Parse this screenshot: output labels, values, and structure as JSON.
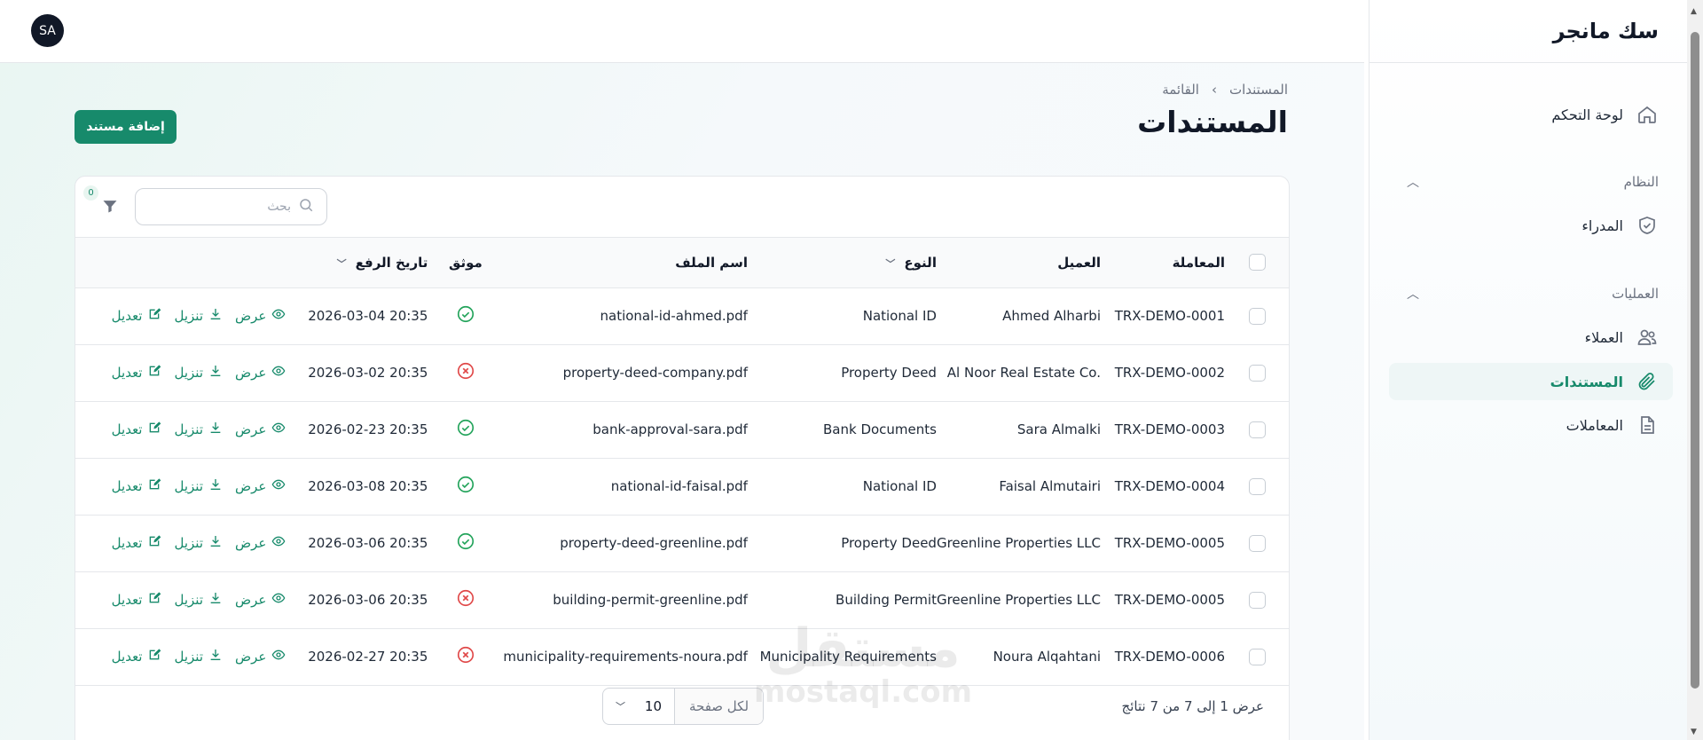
{
  "app": {
    "brand": "سك مانجر",
    "avatar_initials": "SA"
  },
  "sidebar": {
    "dashboard": "لوحة التحكم",
    "system_group": "النظام",
    "admins": "المدراء",
    "operations_group": "العمليات",
    "clients": "العملاء",
    "documents": "المستندات",
    "transactions": "المعاملات"
  },
  "header": {
    "breadcrumb_root": "المستندات",
    "breadcrumb_sep": "›",
    "breadcrumb_current": "القائمة",
    "title": "المستندات",
    "add_button": "إضافة مستند"
  },
  "toolbar": {
    "search_placeholder": "بحث",
    "filter_count": "0"
  },
  "table": {
    "columns": {
      "transaction": "المعاملة",
      "client": "العميل",
      "type": "النوع",
      "filename": "اسم الملف",
      "verified": "موثق",
      "upload_date": "تاريخ الرفع"
    },
    "actions": {
      "view": "عرض",
      "download": "تنزيل",
      "edit": "تعديل"
    },
    "rows": [
      {
        "transaction": "TRX-DEMO-0001",
        "client": "Ahmed Alharbi",
        "type": "National ID",
        "filename": "national-id-ahmed.pdf",
        "verified": true,
        "date": "2026-03-04 20:35"
      },
      {
        "transaction": "TRX-DEMO-0002",
        "client": "Al Noor Real Estate Co.",
        "type": "Property Deed",
        "filename": "property-deed-company.pdf",
        "verified": false,
        "date": "2026-03-02 20:35"
      },
      {
        "transaction": "TRX-DEMO-0003",
        "client": "Sara Almalki",
        "type": "Bank Documents",
        "filename": "bank-approval-sara.pdf",
        "verified": true,
        "date": "2026-02-23 20:35"
      },
      {
        "transaction": "TRX-DEMO-0004",
        "client": "Faisal Almutairi",
        "type": "National ID",
        "filename": "national-id-faisal.pdf",
        "verified": true,
        "date": "2026-03-08 20:35"
      },
      {
        "transaction": "TRX-DEMO-0005",
        "client": "Greenline Properties LLC",
        "type": "Property Deed",
        "filename": "property-deed-greenline.pdf",
        "verified": true,
        "date": "2026-03-06 20:35"
      },
      {
        "transaction": "TRX-DEMO-0005",
        "client": "Greenline Properties LLC",
        "type": "Building Permit",
        "filename": "building-permit-greenline.pdf",
        "verified": false,
        "date": "2026-03-06 20:35"
      },
      {
        "transaction": "TRX-DEMO-0006",
        "client": "Noura Alqahtani",
        "type": "Municipality Requirements",
        "filename": "municipality-requirements-noura.pdf",
        "verified": false,
        "date": "2026-02-27 20:35"
      }
    ]
  },
  "footer": {
    "results_text": "عرض 1 إلى 7 من 7 نتائج",
    "per_page_label": "لكل صفحة",
    "per_page_value": "10"
  },
  "watermark": {
    "line1": "مستقل",
    "line2": "mostaql.com"
  },
  "colors": {
    "accent": "#178a6b",
    "verified": "#22a35a",
    "unverified": "#e04848"
  }
}
